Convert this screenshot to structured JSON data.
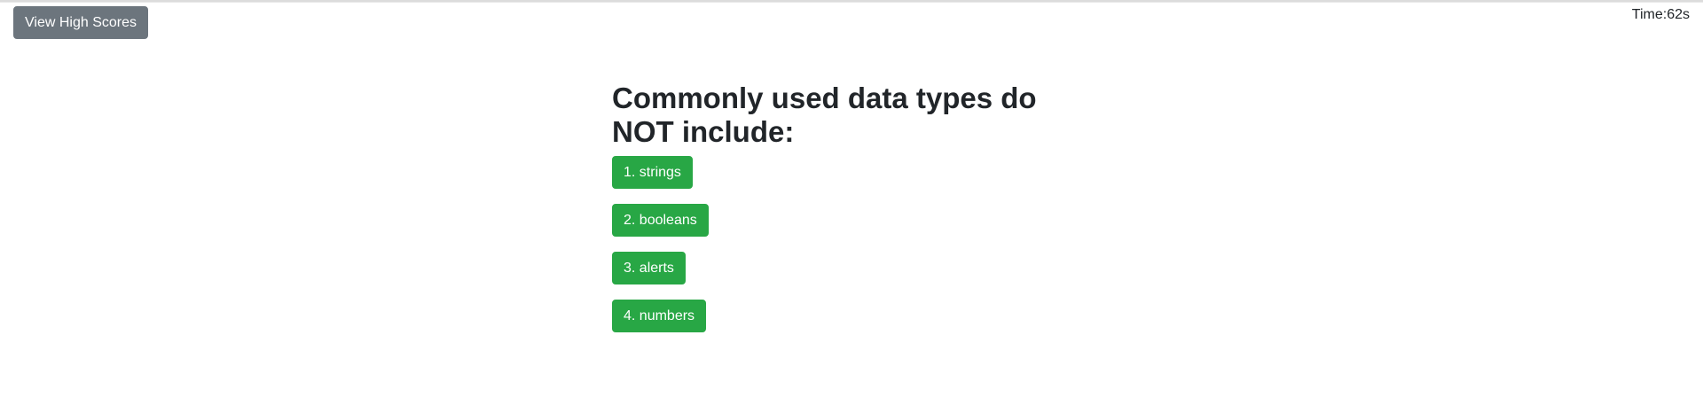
{
  "header": {
    "high_scores_label": "View High Scores",
    "timer_text": "Time:62s"
  },
  "quiz": {
    "question": "Commonly used data types do NOT include:",
    "choices": [
      {
        "label": "1. strings"
      },
      {
        "label": "2. booleans"
      },
      {
        "label": "3. alerts"
      },
      {
        "label": "4. numbers"
      }
    ]
  },
  "colors": {
    "secondary_button": "#6c757d",
    "choice_button": "#28a745",
    "text": "#212529"
  }
}
